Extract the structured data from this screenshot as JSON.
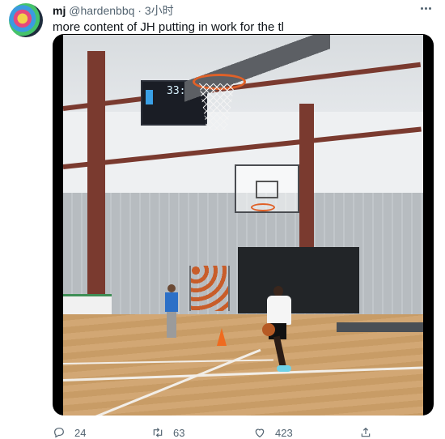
{
  "tweet": {
    "name": "mj",
    "handle": "@hardenbbq",
    "separator": "·",
    "time": "3小时",
    "text": "more content of JH putting in work for the tl"
  },
  "media": {
    "scoreboard_clock": "33:00"
  },
  "actions": {
    "reply_count": "24",
    "retweet_count": "63",
    "like_count": "423"
  },
  "icons": [
    "more-icon",
    "reply-icon",
    "retweet-icon",
    "like-icon",
    "share-icon"
  ],
  "colors": {
    "text": "#0f1419",
    "secondary": "#536471",
    "court_wood": "#c89c66",
    "beam": "#7a3a2f",
    "rim": "#e06128"
  }
}
